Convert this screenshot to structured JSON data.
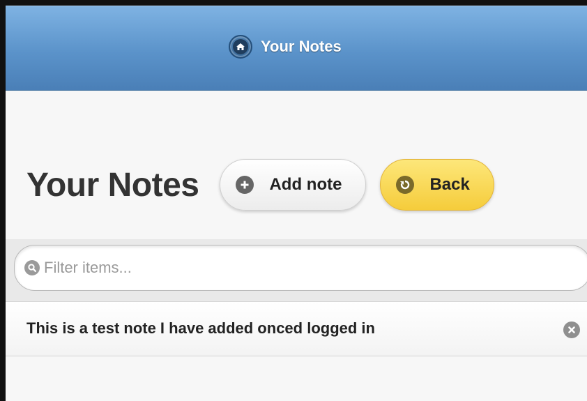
{
  "header": {
    "title": "Your Notes",
    "home_icon": "home-icon",
    "background_color": "#5b93ca"
  },
  "page": {
    "title": "Your Notes",
    "add_button_label": "Add note",
    "add_button_icon": "plus-icon",
    "back_button_label": "Back",
    "back_button_icon": "back-arrow-icon",
    "back_button_color": "#f5cc3b"
  },
  "filter": {
    "placeholder": "Filter items...",
    "value": "",
    "icon": "search-icon"
  },
  "notes": [
    {
      "text": "This is a test note I have added onced logged in",
      "action_icon": "delete-icon"
    }
  ]
}
